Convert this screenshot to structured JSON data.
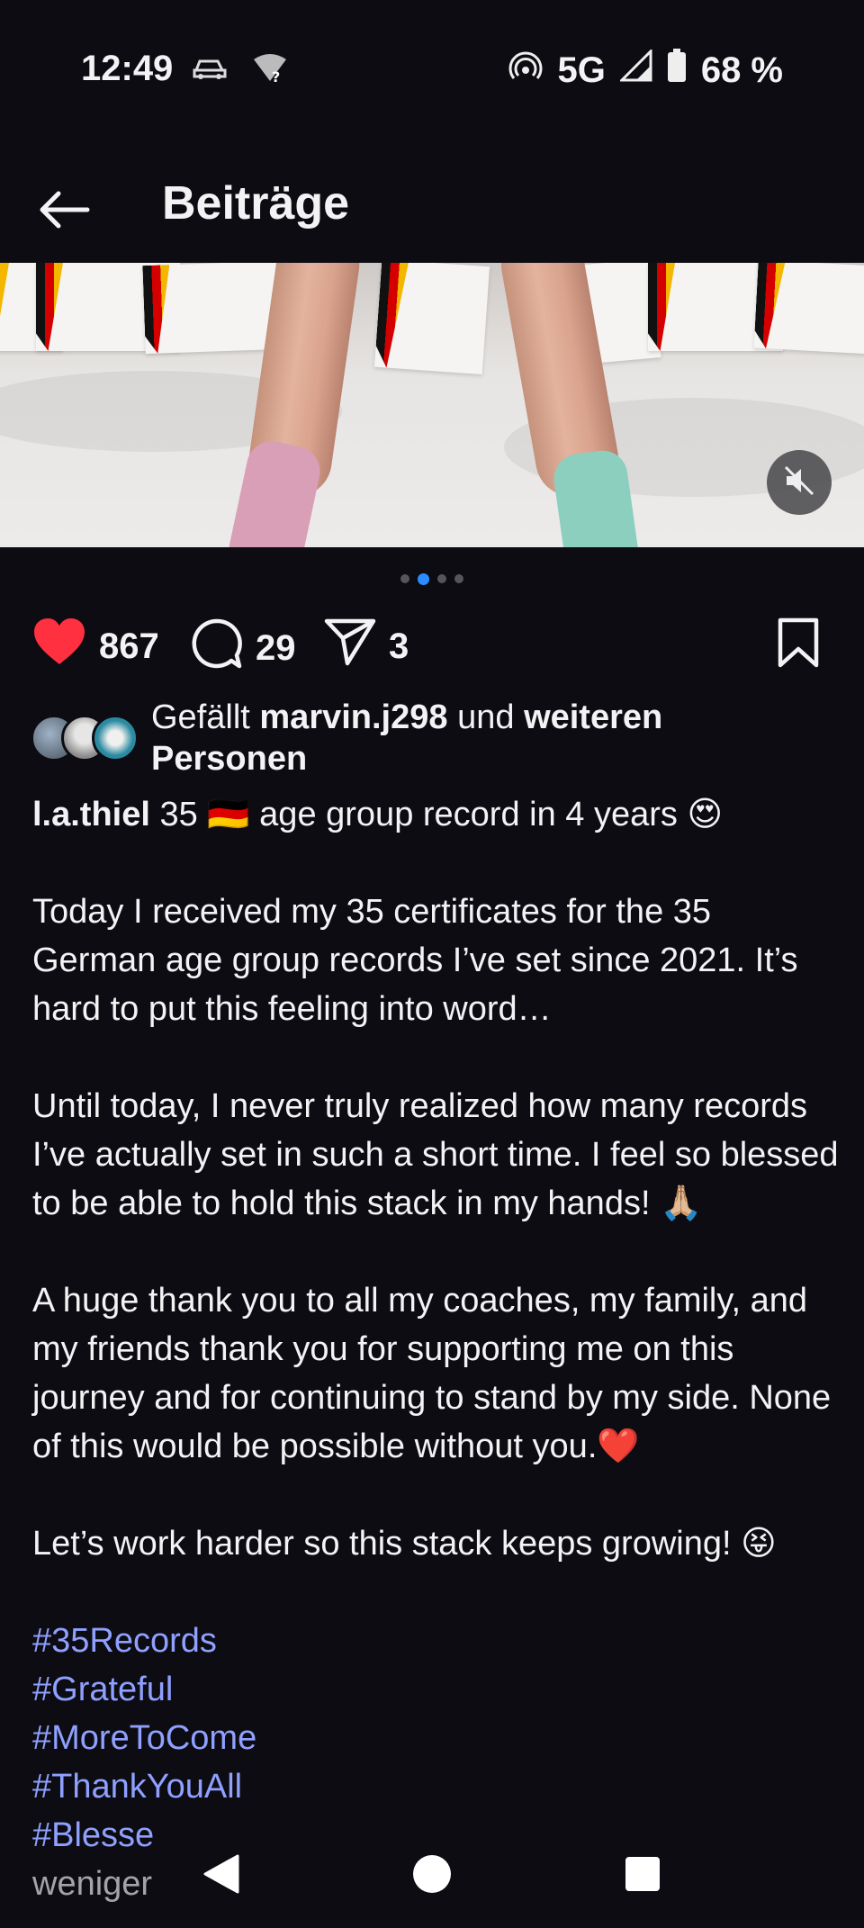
{
  "status_bar": {
    "time": "12:49",
    "network": "5G",
    "battery": "68 %",
    "icons": [
      "car-icon",
      "wifi-question-icon",
      "hotspot-icon",
      "signal-icon",
      "battery-icon"
    ]
  },
  "header": {
    "title": "Beiträge",
    "back_icon": "arrow-left-icon"
  },
  "media": {
    "mute_icon": "volume-off-icon",
    "carousel": {
      "count": 4,
      "active_index": 1
    }
  },
  "actions": {
    "likes": "867",
    "comments": "29",
    "shares": "3",
    "like_color": "#ff3040"
  },
  "liked_by": {
    "prefix": "Gefällt ",
    "user": "marvin.j298",
    "middle": " und ",
    "rest": "weiteren Personen"
  },
  "caption": {
    "username": "l.a.thiel",
    "headline": " 35 🇩🇪 age group record in 4 years 😍",
    "p1": "Today I received my 35 certificates for the 35 German age group records I’ve set since 2021. It’s hard to put this feeling into word…",
    "p2": "Until today, I never truly realized how many records I’ve actually set in such a short time. I feel so blessed to be able to hold this stack in my hands! 🙏🏼",
    "p3": "A huge thank you to all my coaches, my family, and my friends thank you for supporting me on this journey and for continuing to stand by my side. None of this would be possible without you.❤️",
    "p4": "Let’s work harder so this stack keeps growing! 😝",
    "hashtags": [
      "#35Records",
      "#Grateful",
      "#MoreToCome",
      "#ThankYouAll",
      "#Blesse"
    ],
    "less": "weniger"
  },
  "nav_bar": {
    "back": "nav-back-icon",
    "home": "nav-home-icon",
    "recents": "nav-recents-icon"
  }
}
